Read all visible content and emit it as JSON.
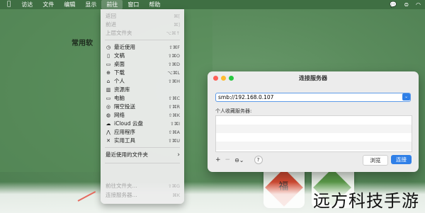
{
  "menubar": {
    "apple": "",
    "items": [
      "访达",
      "文件",
      "编辑",
      "显示",
      "前往",
      "窗口",
      "帮助"
    ],
    "active_index": 4
  },
  "desktop": {
    "sidebar_heading": "常用软",
    "tile_char": "福"
  },
  "go_menu": {
    "rows": [
      {
        "label": "返回",
        "shortcut": "⌘[",
        "icon": "",
        "disabled": true
      },
      {
        "label": "前进",
        "shortcut": "⌘]",
        "icon": "",
        "disabled": true
      },
      {
        "label": "上层文件夹",
        "shortcut": "⌥⌘↑",
        "icon": "",
        "disabled": true
      },
      {
        "label": "最近使用",
        "shortcut": "⇧⌘F",
        "icon": "clock-icon"
      },
      {
        "label": "文稿",
        "shortcut": "⇧⌘O",
        "icon": "document-icon"
      },
      {
        "label": "桌面",
        "shortcut": "⇧⌘D",
        "icon": "desktop-icon"
      },
      {
        "label": "下载",
        "shortcut": "⌥⌘L",
        "icon": "download-icon"
      },
      {
        "label": "个人",
        "shortcut": "⇧⌘H",
        "icon": "home-icon"
      },
      {
        "label": "资源库",
        "shortcut": "",
        "icon": "library-icon"
      },
      {
        "label": "电脑",
        "shortcut": "⇧⌘C",
        "icon": "computer-icon"
      },
      {
        "label": "隔空投送",
        "shortcut": "⇧⌘R",
        "icon": "airdrop-icon"
      },
      {
        "label": "网络",
        "shortcut": "⇧⌘K",
        "icon": "network-icon"
      },
      {
        "label": "iCloud 云盘",
        "shortcut": "⇧⌘I",
        "icon": "icloud-icon"
      },
      {
        "label": "应用程序",
        "shortcut": "⇧⌘A",
        "icon": "applications-icon"
      },
      {
        "label": "实用工具",
        "shortcut": "⇧⌘U",
        "icon": "utilities-icon"
      },
      {
        "label": "最近使用的文件夹",
        "shortcut": "›",
        "icon": ""
      },
      {
        "label": "前往文件夹...",
        "shortcut": "⇧⌘G",
        "icon": "",
        "disabled": true
      },
      {
        "label": "连接服务器...",
        "shortcut": "⌘K",
        "icon": "",
        "disabled": true
      }
    ]
  },
  "dialog": {
    "title": "连接服务器",
    "server_address": "smb://192.168.0.107",
    "favorites_label": "个人收藏服务器:",
    "add_label": "+",
    "remove_label": "−",
    "options_label": "⊖⌄",
    "help_label": "?",
    "browse_label": "浏览",
    "connect_label": "连接"
  },
  "watermark": "远方科技手游",
  "colors": {
    "accent": "#2f7fe7",
    "desktop_green": "#5a8b5c"
  }
}
